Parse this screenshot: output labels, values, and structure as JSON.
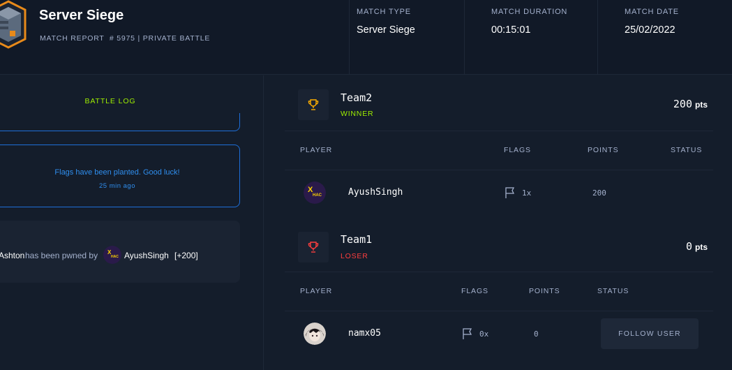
{
  "header": {
    "title": "Server Siege",
    "subtitle": "MATCH REPORT  # 5975 | PRIVATE BATTLE",
    "match_type_label": "MATCH TYPE",
    "match_type_value": "Server Siege",
    "duration_label": "MATCH DURATION",
    "duration_value": "00:15:01",
    "date_label": "MATCH DATE",
    "date_value": "25/02/2022"
  },
  "battle_log": {
    "title": "BATTLE LOG",
    "message": "Flags have been planted. Good luck!",
    "message_time": "25 min ago",
    "event": {
      "victim": "Ashton",
      "text": "has been pwned by",
      "user": "AyushSingh",
      "points": "[+200]"
    }
  },
  "teams": [
    {
      "name": "Team2",
      "result": "WINNER",
      "points": "200",
      "points_unit": "pts",
      "columns": [
        "PLAYER",
        "FLAGS",
        "POINTS",
        "STATUS"
      ],
      "players": [
        {
          "name": "AyushSingh",
          "flags": "1x",
          "points": "200"
        }
      ]
    },
    {
      "name": "Team1",
      "result": "LOSER",
      "points": "0",
      "points_unit": "pts",
      "columns": [
        "PLAYER",
        "FLAGS",
        "POINTS",
        "STATUS"
      ],
      "players": [
        {
          "name": "namx05",
          "flags": "0x",
          "points": "0",
          "action": "FOLLOW USER"
        }
      ]
    }
  ],
  "colors": {
    "accent_green": "#9fef00",
    "winner": "#9fef00",
    "loser": "#ff3e3e",
    "trophy_winner": "#ffaf00",
    "trophy_loser": "#ff3e3e",
    "log_blue": "#2f8eee"
  },
  "icons": {
    "game": "server-siege-icon",
    "trophy": "trophy-icon",
    "flag": "flag-icon"
  }
}
